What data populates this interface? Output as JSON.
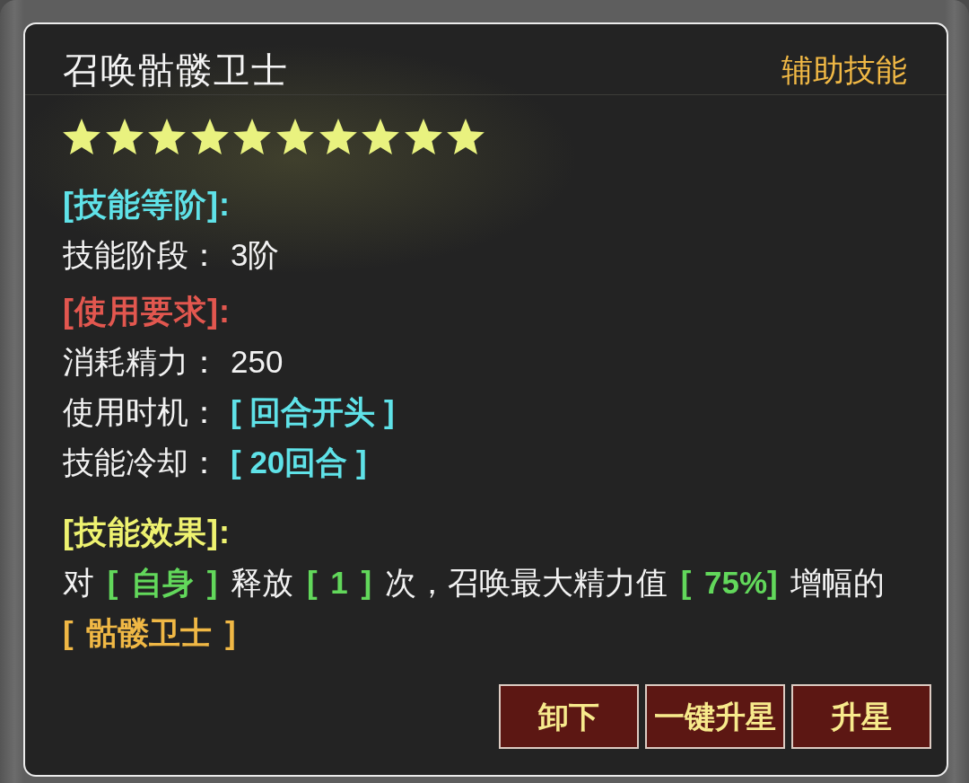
{
  "skill": {
    "name": "召唤骷髅卫士",
    "type": "辅助技能",
    "stars": 10
  },
  "sections": [
    {
      "kind": "stats",
      "heading": "[技能等阶]:",
      "color": "#5fe2e8",
      "rows": [
        {
          "label": "技能阶段：",
          "value": "3阶",
          "highlight": false
        }
      ]
    },
    {
      "kind": "stats",
      "heading": "[使用要求]:",
      "color": "#e2574f",
      "rows": [
        {
          "label": "消耗精力：",
          "value": "250",
          "highlight": false
        },
        {
          "label": "使用时机：",
          "value": "[ 回合开头 ]",
          "highlight": true
        },
        {
          "label": "技能冷却：",
          "value": "[ 20回合 ]",
          "highlight": true
        }
      ]
    },
    {
      "kind": "effect",
      "heading": "[技能效果]:",
      "color": "#eef270",
      "segments": [
        {
          "kind": "text",
          "text": "对 "
        },
        {
          "kind": "param",
          "text": "[ 自身 ]"
        },
        {
          "kind": "text",
          "text": " 释放 "
        },
        {
          "kind": "param",
          "text": "[ 1 ]"
        },
        {
          "kind": "text",
          "text": " 次，召唤最大精力值 "
        },
        {
          "kind": "param",
          "text": "[ 75%]"
        },
        {
          "kind": "text",
          "text": " 增幅的 "
        },
        {
          "kind": "summon",
          "text": "[ 骷髅卫士 ]"
        }
      ]
    }
  ],
  "buttons": [
    "卸下",
    "一键升星",
    "升星"
  ]
}
